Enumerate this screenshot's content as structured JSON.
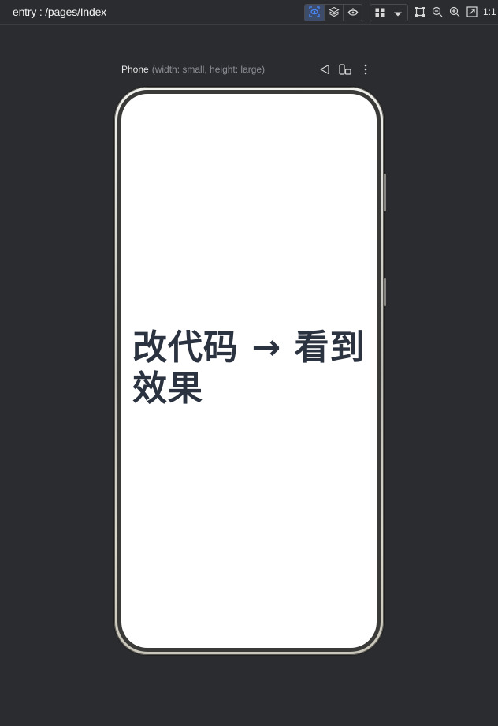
{
  "window": {
    "title": "entry : /pages/Index"
  },
  "toolbar": {
    "icons": [
      "inspect-eye-icon",
      "layers-icon",
      "preview-eye-icon",
      "grid-layout-icon",
      "dropdown-icon",
      "fit-frame-icon",
      "zoom-out-icon",
      "zoom-in-icon",
      "fit-screen-icon"
    ],
    "ratio_label": "1:1",
    "accent_color": "#4a8cff"
  },
  "device": {
    "name": "Phone",
    "spec": "(width: small, height: large)",
    "actions": [
      "rotate-triangle-icon",
      "multi-device-icon",
      "more-vertical-icon"
    ]
  },
  "screen": {
    "content_text": "改代码 → 看到效果",
    "text_color": "#2b3340",
    "background": "#ffffff"
  }
}
